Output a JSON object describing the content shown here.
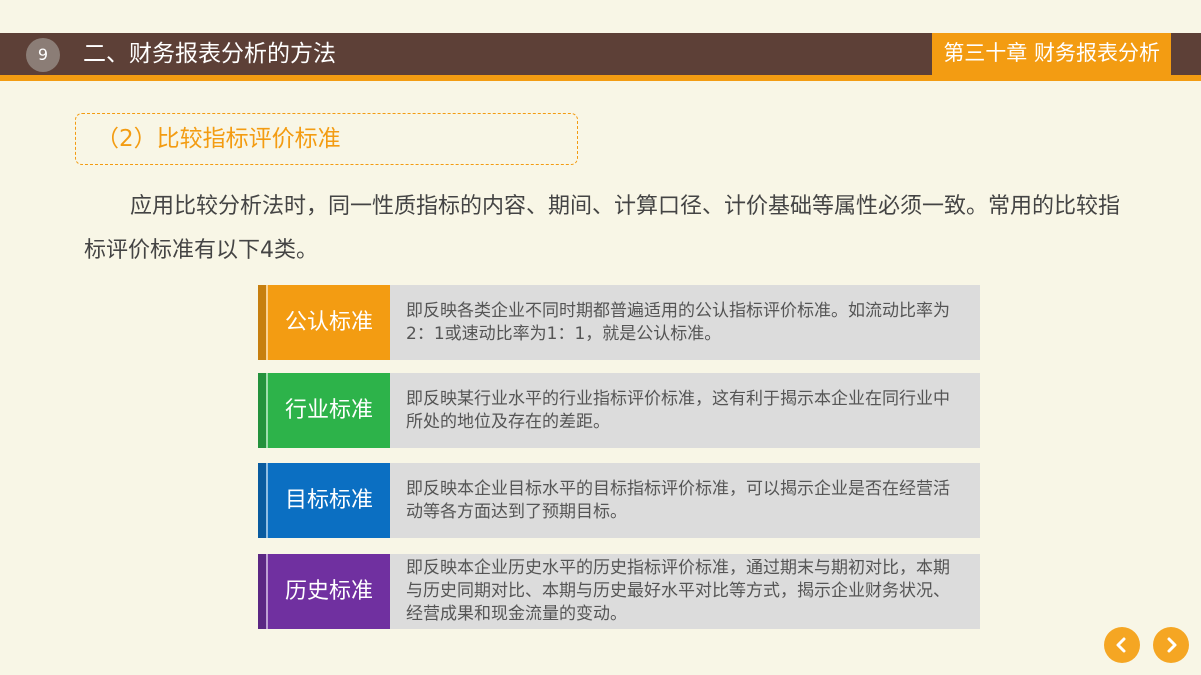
{
  "header": {
    "page_number": "9",
    "title": "二、财务报表分析的方法",
    "chapter": "第三十章 财务报表分析"
  },
  "section": {
    "subtitle": "（2）比较指标评价标准",
    "intro": "应用比较分析法时，同一性质指标的内容、期间、计算口径、计价基础等属性必须一致。常用的比较指标评价标准有以下4类。"
  },
  "standards": [
    {
      "label": "公认标准",
      "color": "#f39c12",
      "desc": "即反映各类企业不同时期都普遍适用的公认指标评价标准。如流动比率为2：1或速动比率为1：1，就是公认标准。"
    },
    {
      "label": "行业标准",
      "color": "#2db34a",
      "desc": "即反映某行业水平的行业指标评价标准，这有利于揭示本企业在同行业中所处的地位及存在的差距。"
    },
    {
      "label": "目标标准",
      "color": "#0b6fc2",
      "desc": "即反映本企业目标水平的目标指标评价标准，可以揭示企业是否在经营活动等各方面达到了预期目标。"
    },
    {
      "label": "历史标准",
      "color": "#7030a0",
      "desc": "即反映本企业历史水平的历史指标评价标准，通过期末与期初对比，本期与历史同期对比、本期与历史最好水平对比等方式，揭示企业财务状况、经营成果和现金流量的变动。"
    }
  ],
  "nav": {
    "prev_icon": "chevron-left-icon",
    "next_icon": "chevron-right-icon",
    "color": "#f5a623"
  }
}
